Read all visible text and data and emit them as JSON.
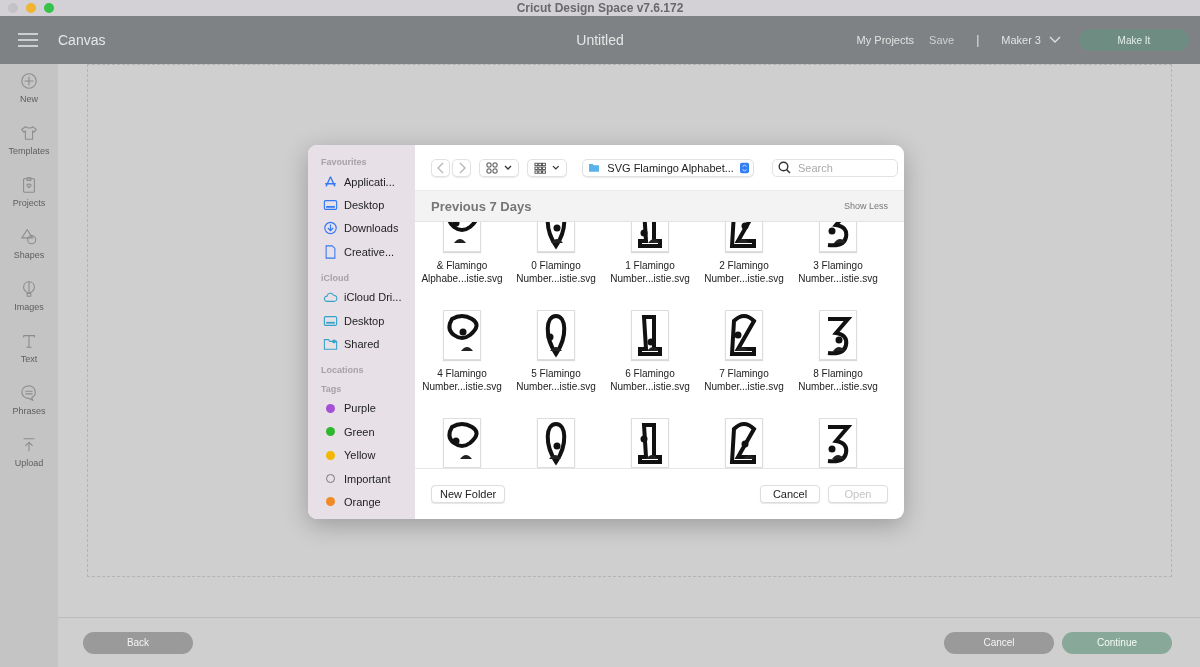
{
  "window": {
    "title": "Cricut Design Space  v7.6.172"
  },
  "topbar": {
    "section": "Canvas",
    "document": "Untitled",
    "my_projects": "My Projects",
    "save": "Save",
    "separator": "|",
    "machine": "Maker 3",
    "make_it": "Make It"
  },
  "rail": [
    {
      "label": "New"
    },
    {
      "label": "Templates"
    },
    {
      "label": "Projects"
    },
    {
      "label": "Shapes"
    },
    {
      "label": "Images"
    },
    {
      "label": "Text"
    },
    {
      "label": "Phrases"
    },
    {
      "label": "Upload"
    }
  ],
  "bottom": {
    "back": "Back",
    "cancel": "Cancel",
    "continue": "Continue"
  },
  "dialog": {
    "sidebar": [
      {
        "heading": "Favourites",
        "items": [
          {
            "label": "Applicati...",
            "kind": "apps"
          },
          {
            "label": "Desktop",
            "kind": "desktop"
          },
          {
            "label": "Downloads",
            "kind": "downloads"
          },
          {
            "label": "Creative...",
            "kind": "document"
          }
        ]
      },
      {
        "heading": "iCloud",
        "items": [
          {
            "label": "iCloud Dri...",
            "kind": "cloud"
          },
          {
            "label": "Desktop",
            "kind": "desktop"
          },
          {
            "label": "Shared",
            "kind": "shared"
          }
        ]
      },
      {
        "heading": "Locations"
      },
      {
        "heading": "Tags",
        "items": [
          {
            "label": "Purple",
            "kind": "tag",
            "color": "#a550d6"
          },
          {
            "label": "Green",
            "kind": "tag",
            "color": "#2fb82f"
          },
          {
            "label": "Yellow",
            "kind": "tag",
            "color": "#f2b705"
          },
          {
            "label": "Important",
            "kind": "tag-empty"
          },
          {
            "label": "Orange",
            "kind": "tag",
            "color": "#f08a24"
          }
        ]
      }
    ],
    "folder": "SVG Flamingo Alphabet...",
    "search": {
      "placeholder": "Search"
    },
    "section": "Previous 7 Days",
    "show_less": "Show Less",
    "files": [
      {
        "kind": "file",
        "line1": "& Flamingo",
        "line2": "Alphabe...istie.svg"
      },
      {
        "kind": "file",
        "line1": "0 Flamingo",
        "line2": "Number...istie.svg"
      },
      {
        "kind": "file",
        "line1": "1 Flamingo",
        "line2": "Number...istie.svg"
      },
      {
        "kind": "file",
        "line1": "2 Flamingo",
        "line2": "Number...istie.svg"
      },
      {
        "kind": "file",
        "line1": "3 Flamingo",
        "line2": "Number...istie.svg"
      },
      {
        "kind": "file",
        "line1": "4 Flamingo",
        "line2": "Number...istie.svg"
      },
      {
        "kind": "file",
        "line1": "5 Flamingo",
        "line2": "Number...istie.svg"
      },
      {
        "kind": "file",
        "line1": "6 Flamingo",
        "line2": "Number...istie.svg"
      },
      {
        "kind": "file",
        "line1": "7 Flamingo",
        "line2": "Number...istie.svg"
      },
      {
        "kind": "file",
        "line1": "8 Flamingo",
        "line2": "Number...istie.svg"
      },
      {
        "kind": "picture"
      },
      {
        "kind": "picture"
      },
      {
        "kind": "picture"
      },
      {
        "kind": "picture"
      },
      {
        "kind": "picture"
      }
    ],
    "new_folder": "New Folder",
    "cancel": "Cancel",
    "open": "Open"
  }
}
